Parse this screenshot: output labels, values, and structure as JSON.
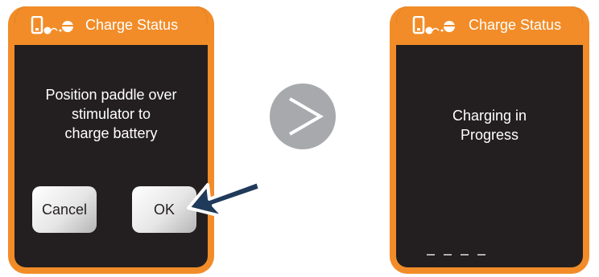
{
  "left_screen": {
    "title": "Charge Status",
    "message_lines": [
      "Position paddle over",
      "stimulator to",
      "charge battery"
    ],
    "cancel_label": "Cancel",
    "ok_label": "OK"
  },
  "right_screen": {
    "title": "Charge Status",
    "message_lines": [
      "Charging in",
      "Progress"
    ],
    "progress_indicator": "– – – –"
  },
  "icons": {
    "device": "charger-device-icon",
    "next": "chevron-right-icon",
    "pointer": "pointer-arrow-icon"
  },
  "colors": {
    "accent": "#f28c28",
    "screen_bg": "#231f20",
    "next_circle": "#a7a9ac",
    "pointer_arrow": "#1f3a5a"
  }
}
